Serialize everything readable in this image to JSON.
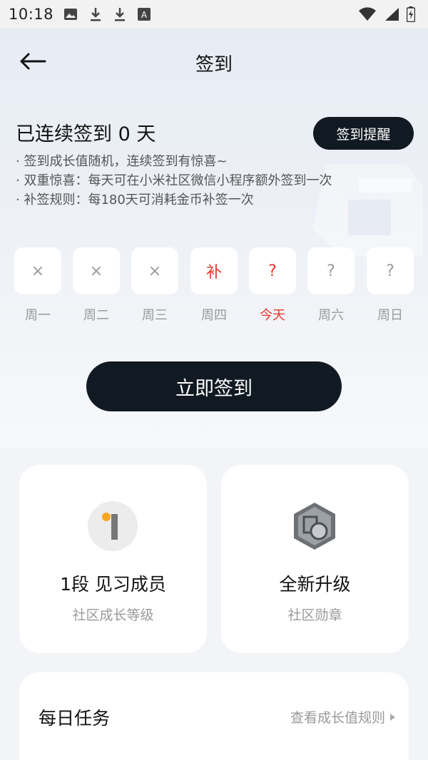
{
  "status_bar": {
    "time": "10:18",
    "left_icons": [
      "gallery-icon",
      "download-icon",
      "download-icon",
      "translate-icon"
    ],
    "right_icons": [
      "wifi-icon",
      "signal-icon",
      "battery-icon"
    ]
  },
  "nav": {
    "title": "签到",
    "back_icon": "arrow-left-icon"
  },
  "streak": {
    "title": "已连续签到 0 天",
    "remind_label": "签到提醒",
    "rules": [
      "· 签到成长值随机，连续签到有惊喜~",
      "· 双重惊喜：每天可在小米社区微信小程序额外签到一次",
      "· 补签规则：每180天可消耗金币补签一次"
    ]
  },
  "week": [
    {
      "mark": "×",
      "label": "周一",
      "highlight": false
    },
    {
      "mark": "×",
      "label": "周二",
      "highlight": false
    },
    {
      "mark": "×",
      "label": "周三",
      "highlight": false
    },
    {
      "mark": "补",
      "label": "周四",
      "highlight": true
    },
    {
      "mark": "?",
      "label": "今天",
      "highlight": true
    },
    {
      "mark": "?",
      "label": "周六",
      "highlight": false
    },
    {
      "mark": "?",
      "label": "周日",
      "highlight": false
    }
  ],
  "signin_label": "立即签到",
  "level_card": {
    "title": "1段 见习成员",
    "subtitle": "社区成长等级",
    "icon": "level-1-icon"
  },
  "badge_card": {
    "title": "全新升级",
    "subtitle": "社区勋章",
    "icon": "medal-icon"
  },
  "tasks": {
    "title": "每日任务",
    "link_label": "查看成长值规则"
  },
  "colors": {
    "accent_red": "#e6372b",
    "button_dark": "#111922",
    "level_dot": "#f5a623"
  }
}
